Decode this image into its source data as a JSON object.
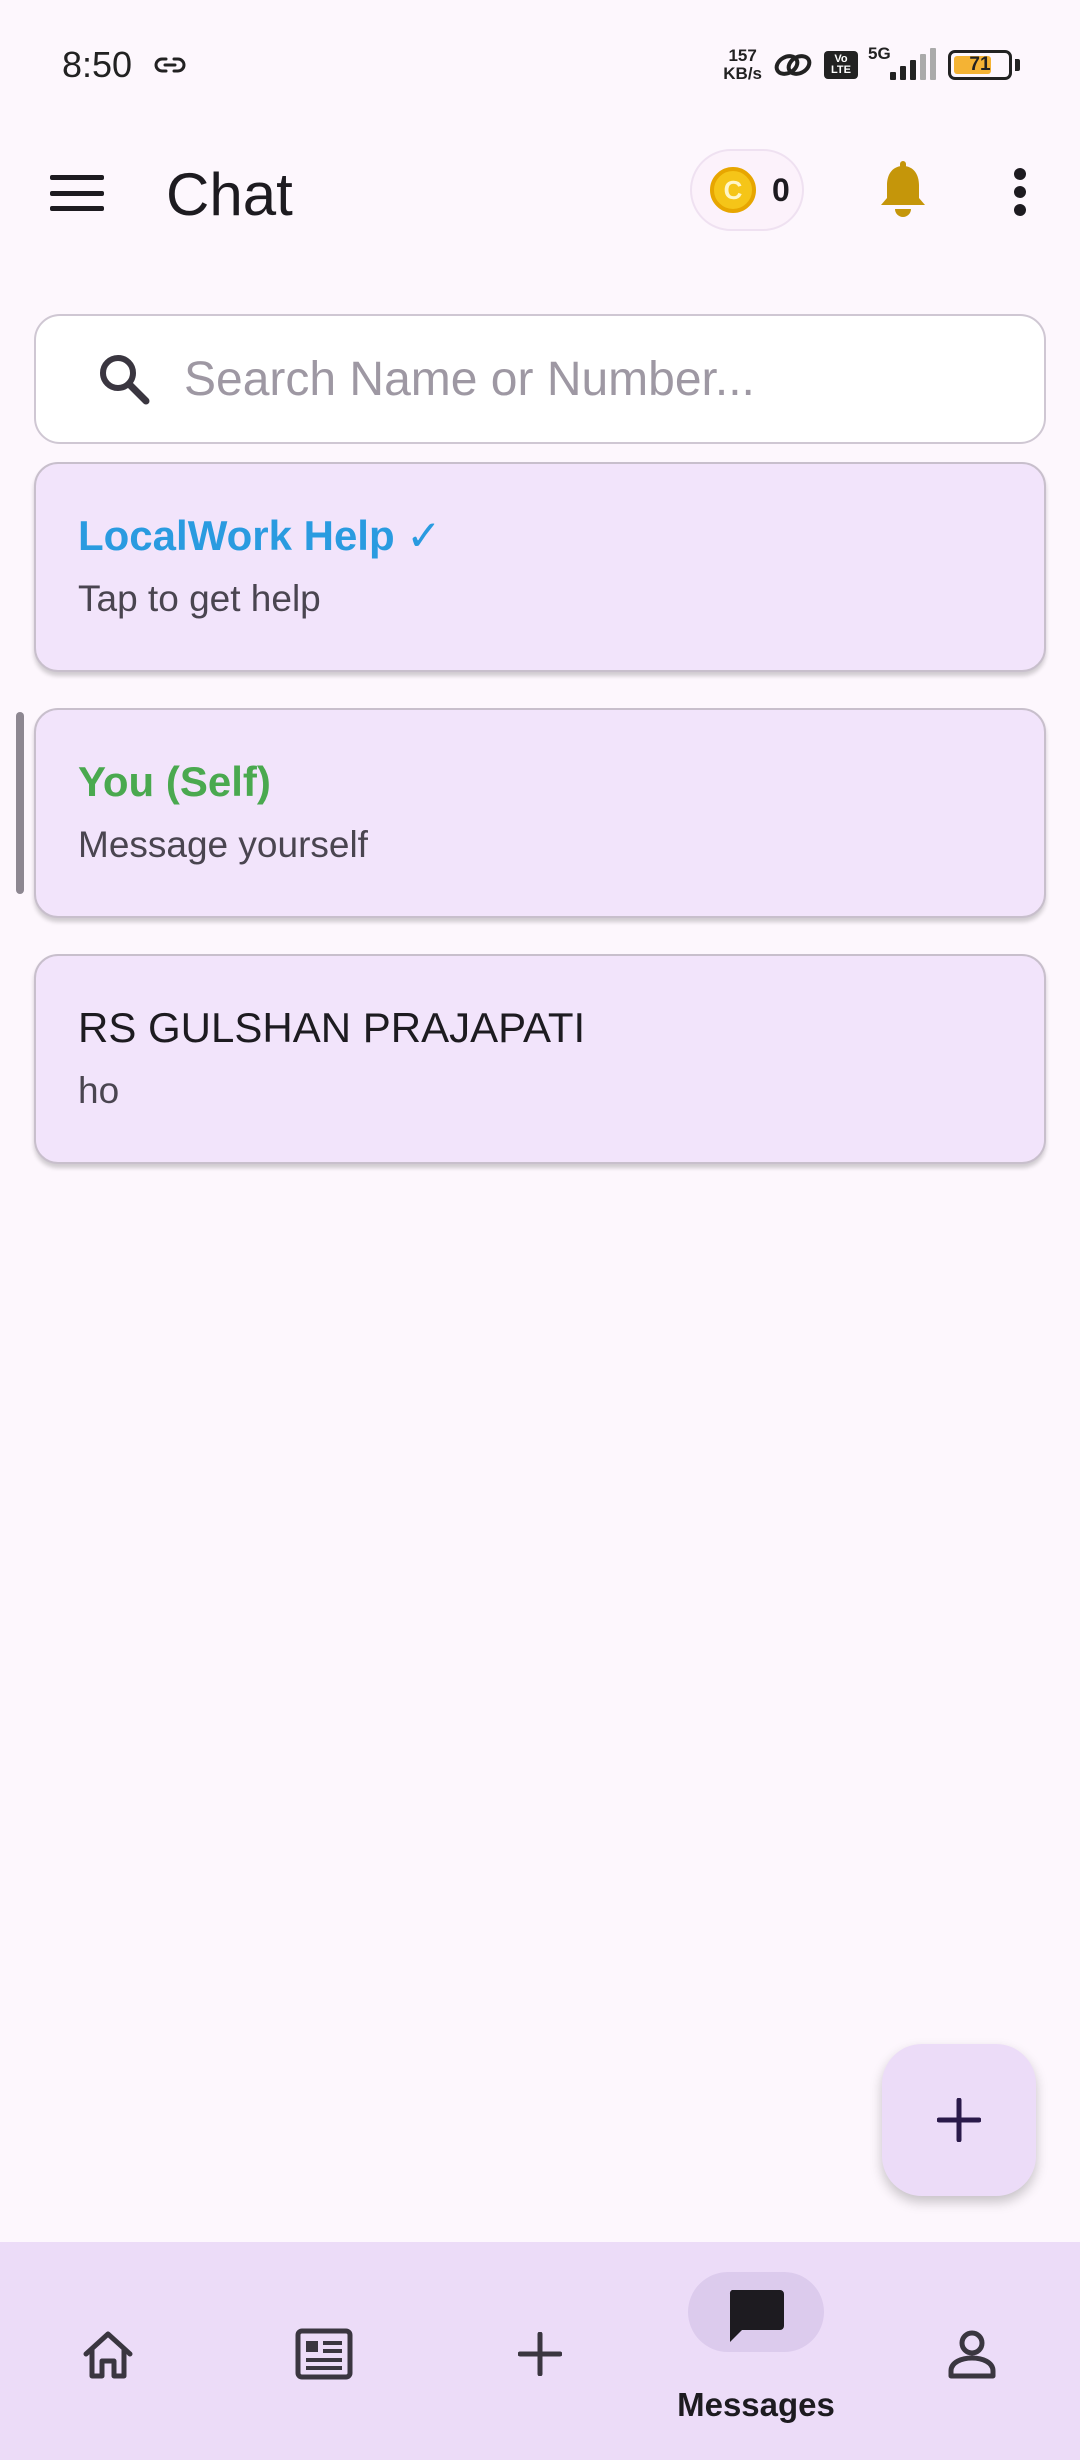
{
  "status_bar": {
    "time": "8:50",
    "net_speed_value": "157",
    "net_speed_unit": "KB/s",
    "volte_top": "Vo",
    "volte_bottom": "LTE",
    "network": "5G",
    "battery_level": "71",
    "battery_color": "#f4b334"
  },
  "app_bar": {
    "title": "Chat",
    "coin_symbol": "C",
    "coin_count": "0",
    "icons": [
      "menu-icon",
      "coin-icon",
      "bell-icon",
      "more-vert-icon"
    ]
  },
  "search": {
    "placeholder": "Search Name or Number..."
  },
  "chats": [
    {
      "name": "LocalWork Help ✓",
      "subtitle": "Tap to get help",
      "color": "#2a9be0"
    },
    {
      "name": "You (Self)",
      "subtitle": "Message yourself",
      "color": "#4aa94f"
    },
    {
      "name": "RS GULSHAN PRAJAPATI",
      "subtitle": "ho",
      "color": "#1d1b20"
    }
  ],
  "fab": {
    "icon": "plus-icon"
  },
  "bottom_nav": {
    "items": [
      {
        "icon": "home-icon",
        "label": ""
      },
      {
        "icon": "article-icon",
        "label": ""
      },
      {
        "icon": "plus-icon",
        "label": ""
      },
      {
        "icon": "chat-icon",
        "label": "Messages",
        "active": true
      },
      {
        "icon": "person-icon",
        "label": ""
      }
    ]
  }
}
